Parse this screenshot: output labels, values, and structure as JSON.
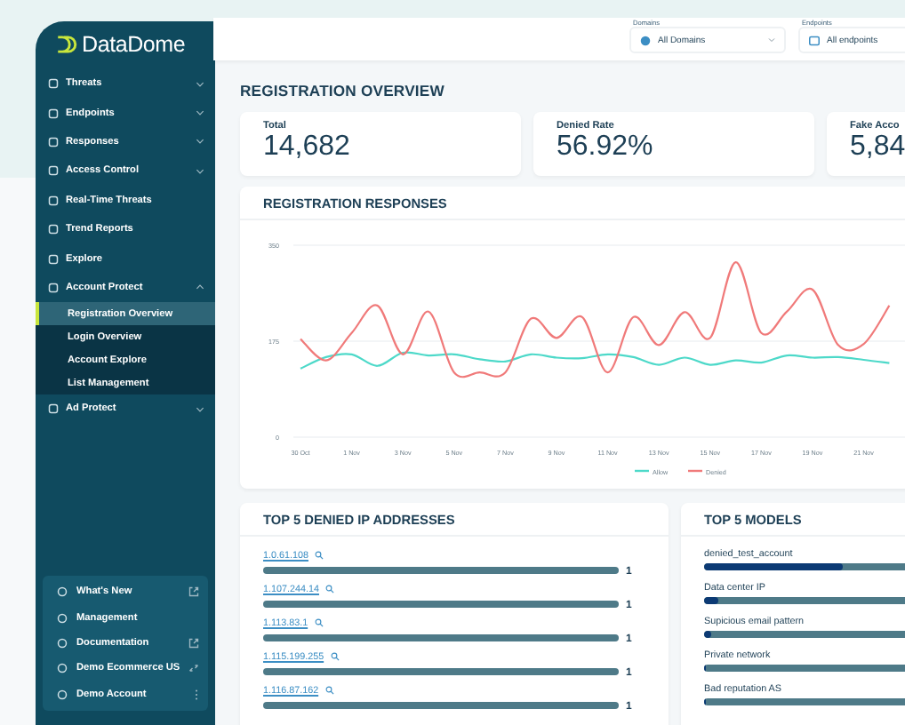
{
  "sidebar": {
    "logo": "DataDome",
    "items": [
      {
        "label": "Threats",
        "kind": "group",
        "expanded": false
      },
      {
        "label": "Endpoints",
        "kind": "group",
        "expanded": false
      },
      {
        "label": "Responses",
        "kind": "group",
        "expanded": false
      },
      {
        "label": "Access Control",
        "kind": "group",
        "expanded": false
      },
      {
        "label": "Real-Time Threats",
        "kind": "link"
      },
      {
        "label": "Trend Reports",
        "kind": "link"
      },
      {
        "label": "Explore",
        "kind": "link"
      },
      {
        "label": "Account Protect",
        "kind": "group",
        "expanded": true,
        "children": [
          {
            "label": "Registration Overview",
            "selected": true
          },
          {
            "label": "Login Overview",
            "selected": false
          },
          {
            "label": "Account Explore",
            "selected": false
          },
          {
            "label": "List Management",
            "selected": false
          }
        ]
      },
      {
        "label": "Ad Protect",
        "kind": "group",
        "expanded": false
      }
    ],
    "footer": [
      {
        "label": "What's New",
        "kind": "external"
      },
      {
        "label": "Management",
        "kind": "plain"
      },
      {
        "label": "Documentation",
        "kind": "external"
      },
      {
        "label": "Demo Ecommerce US",
        "kind": "switch"
      },
      {
        "label": "Demo Account",
        "kind": "menu"
      }
    ]
  },
  "filters": [
    {
      "label": "Domains",
      "value": "All Domains"
    },
    {
      "label": "Endpoints",
      "value": "All endpoints"
    }
  ],
  "page_title": "REGISTRATION OVERVIEW",
  "stats": [
    {
      "label": "Total",
      "value": "14,682"
    },
    {
      "label": "Denied Rate",
      "value": "56.92%"
    },
    {
      "label": "Fake Acco",
      "value": "5,84"
    }
  ],
  "responses": {
    "title": "REGISTRATION RESPONSES",
    "chart_data": {
      "type": "line",
      "categories": [
        "30 Oct",
        null,
        "1 Nov",
        null,
        "3 Nov",
        null,
        "5 Nov",
        null,
        "7 Nov",
        null,
        "9 Nov",
        null,
        "11 Nov",
        null,
        "13 Nov",
        null,
        "15 Nov",
        null,
        "17 Nov",
        null,
        "19 Nov",
        null,
        "21 Nov",
        null
      ],
      "legend": "bottom",
      "series": [
        {
          "name": "Allow",
          "color": "#4dd9c9",
          "values": [
            125,
            146,
            151,
            130,
            154,
            149,
            151,
            142,
            138,
            151,
            145,
            144,
            151,
            146,
            132,
            145,
            132,
            140,
            136,
            149,
            145,
            146,
            141,
            135
          ]
        },
        {
          "name": "Denied",
          "color": "#f07a7a",
          "values": [
            179,
            140,
            190,
            240,
            151,
            229,
            118,
            118,
            118,
            216,
            181,
            219,
            118,
            219,
            168,
            228,
            181,
            319,
            190,
            229,
            269,
            168,
            170,
            240
          ]
        }
      ],
      "ylim": [
        0,
        350
      ],
      "yticks": [
        0,
        175,
        350
      ]
    }
  },
  "denied_ips": {
    "title": "TOP 5 DENIED IP ADDRESSES",
    "rows": [
      {
        "ip": "1.0.61.108",
        "value": "1"
      },
      {
        "ip": "1.107.244.14",
        "value": "1"
      },
      {
        "ip": "1.113.83.1",
        "value": "1"
      },
      {
        "ip": "1.115.199.255",
        "value": "1"
      },
      {
        "ip": "1.116.87.162",
        "value": "1"
      }
    ]
  },
  "models": {
    "title": "TOP 5 MODELS",
    "rows": [
      {
        "label": "denied_test_account",
        "level": 0.56
      },
      {
        "label": "Data center IP",
        "level": 0.06
      },
      {
        "label": "Supicious email pattern",
        "level": 0.03
      },
      {
        "label": "Private network",
        "level": 0.01
      },
      {
        "label": "Bad reputation AS",
        "level": 0.01
      }
    ]
  }
}
